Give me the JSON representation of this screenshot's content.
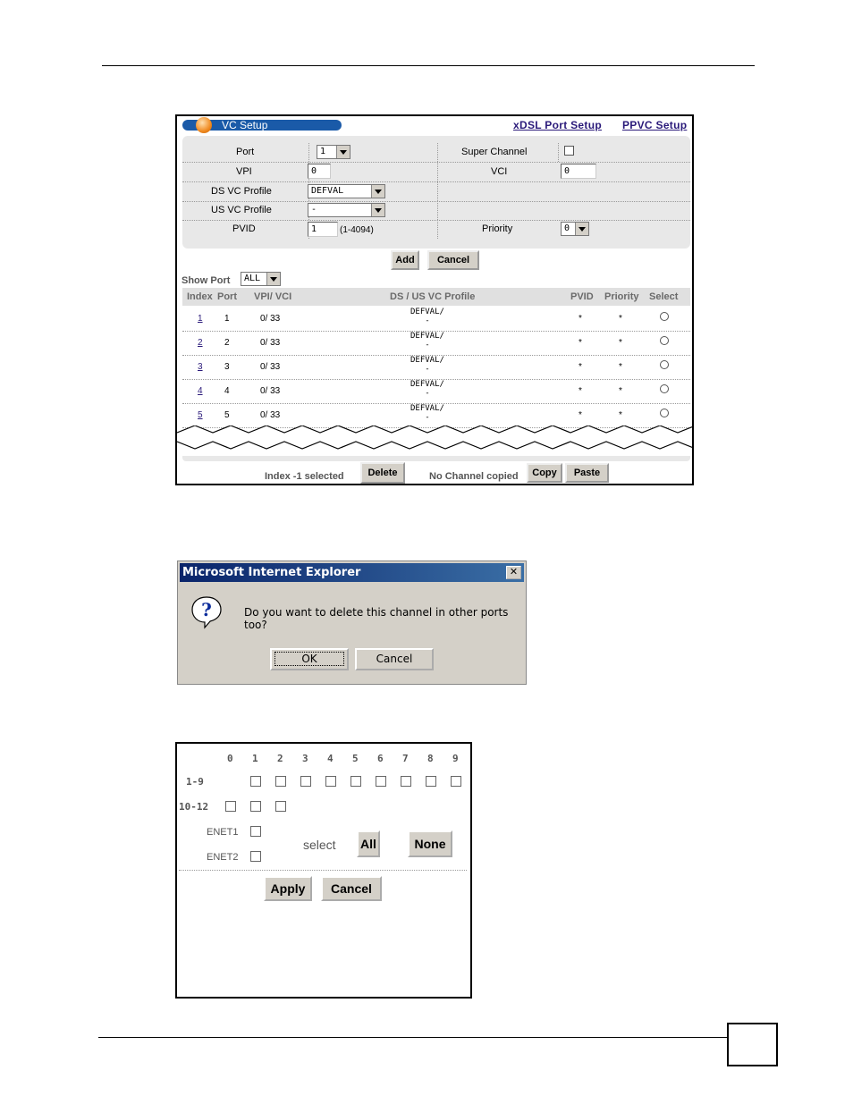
{
  "vc_setup": {
    "title": "VC Setup",
    "links": {
      "xdsl": "xDSL Port Setup",
      "ppvc": "PPVC Setup"
    },
    "form": {
      "port_label": "Port",
      "port_value": "1",
      "super_channel_label": "Super Channel",
      "vpi_label": "VPI",
      "vpi_value": "0",
      "vci_label": "VCI",
      "vci_value": "0",
      "ds_profile_label": "DS VC Profile",
      "ds_profile_value": "DEFVAL",
      "us_profile_label": "US VC Profile",
      "us_profile_value": "-",
      "pvid_label": "PVID",
      "pvid_value": "1",
      "pvid_range": "(1-4094)",
      "priority_label": "Priority",
      "priority_value": "0"
    },
    "add_label": "Add",
    "cancel_label": "Cancel",
    "show_port_label": "Show  Port",
    "show_port_value": "ALL",
    "table": {
      "headers": [
        "Index",
        "Port",
        "VPI/ VCI",
        "DS / US VC Profile",
        "PVID",
        "Priority",
        "Select"
      ],
      "rows": [
        {
          "index": "1",
          "port": "1",
          "vpivci": "0/ 33",
          "ds": "DEFVAL/",
          "us": "-",
          "pvid": "*",
          "priority": "*"
        },
        {
          "index": "2",
          "port": "2",
          "vpivci": "0/ 33",
          "ds": "DEFVAL/",
          "us": "-",
          "pvid": "*",
          "priority": "*"
        },
        {
          "index": "3",
          "port": "3",
          "vpivci": "0/ 33",
          "ds": "DEFVAL/",
          "us": "-",
          "pvid": "*",
          "priority": "*"
        },
        {
          "index": "4",
          "port": "4",
          "vpivci": "0/ 33",
          "ds": "DEFVAL/",
          "us": "-",
          "pvid": "*",
          "priority": "*"
        },
        {
          "index": "5",
          "port": "5",
          "vpivci": "0/ 33",
          "ds": "DEFVAL/",
          "us": "-",
          "pvid": "*",
          "priority": "*"
        }
      ]
    },
    "footer": {
      "selected_text": "Index -1 selected",
      "delete_label": "Delete",
      "copied_text": "No Channel copied",
      "copy_label": "Copy",
      "paste_label": "Paste"
    }
  },
  "dialog": {
    "title": "Microsoft Internet Explorer",
    "close": "✕",
    "message": "Do you want to delete this channel in other ports too?",
    "ok_label": "OK",
    "cancel_label": "Cancel",
    "icon": "question-icon"
  },
  "port_select": {
    "column_numbers": [
      "0",
      "1",
      "2",
      "3",
      "4",
      "5",
      "6",
      "7",
      "8",
      "9"
    ],
    "row1_label": "1-9",
    "row2_label": "10-12",
    "enet1_label": "ENET1",
    "enet2_label": "ENET2",
    "select_label": "select",
    "all_label": "All",
    "none_label": "None",
    "apply_label": "Apply",
    "cancel_label": "Cancel"
  }
}
